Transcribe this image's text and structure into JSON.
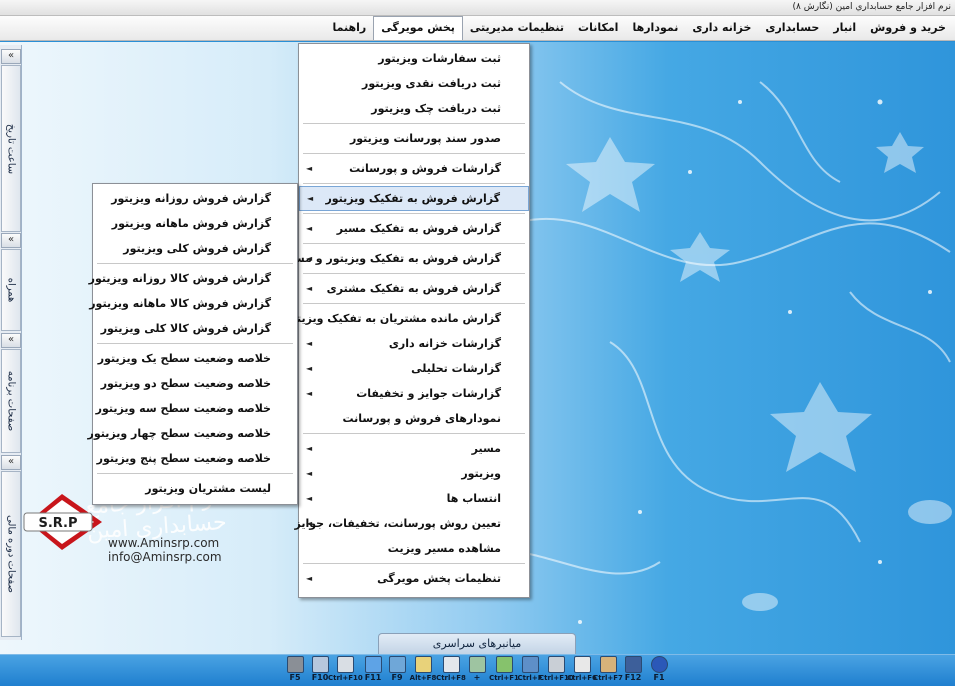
{
  "window": {
    "title": "نرم افزار جامع حسابداري امين (نگارش ۸)"
  },
  "menubar": {
    "items": [
      "خرید و فروش",
      "انبار",
      "حسابداری",
      "خزانه داری",
      "نمودارها",
      "امکانات",
      "تنظیمات مدیریتی",
      "پخش مویرگی",
      "راهنما"
    ],
    "active": "پخش مویرگی"
  },
  "dropdown": {
    "items": [
      {
        "label": "ثبت سفارشات ویزیتور",
        "submenu": false
      },
      {
        "label": "ثبت دریافت نقدی ویزیتور",
        "submenu": false
      },
      {
        "label": "ثبت دریافت چک ویزیتور",
        "submenu": false
      },
      {
        "label": "صدور سند پورسانت ویزیتور",
        "submenu": false
      },
      {
        "label": "گزارشات فروش و پورسانت",
        "submenu": true
      },
      {
        "label": "گزارش فروش به تفکیک ویزیتور",
        "submenu": true,
        "highlighted": true
      },
      {
        "label": "گزارش فروش به تفکیک مسیر",
        "submenu": true
      },
      {
        "label": "گزارش فروش به تفکیک ویزیتور و مسیر",
        "submenu": true
      },
      {
        "label": "گزارش فروش به تفکیک مشتری",
        "submenu": true
      },
      {
        "label": "گزارش مانده مشتریان به تفکیک ویزیتور",
        "submenu": false
      },
      {
        "label": "گزارشات خزانه داری",
        "submenu": true
      },
      {
        "label": "گزارشات تحلیلی",
        "submenu": true
      },
      {
        "label": "گزارشات جوایز و تخفیفات",
        "submenu": true
      },
      {
        "label": "نمودارهای فروش و پورسانت",
        "submenu": false
      },
      {
        "label": "مسیر",
        "submenu": true
      },
      {
        "label": "ویزیتور",
        "submenu": true
      },
      {
        "label": "انتساب ها",
        "submenu": true
      },
      {
        "label": "تعیین روش پورسانت، تخفیفات، جوایز",
        "submenu": true
      },
      {
        "label": "مشاهده مسیر ویزیت",
        "submenu": false
      },
      {
        "label": "تنظیمات پخش مویرگی",
        "submenu": true
      }
    ]
  },
  "submenu": {
    "items": [
      "گزارش فروش روزانه ویزیتور",
      "گزارش فروش ماهانه ویزیتور",
      "گزارش فروش کلی ویزیتور",
      "گزارش فروش کالا روزانه ویزیتور",
      "گزارش فروش کالا ماهانه ویزیتور",
      "گزارش فروش کالا کلی ویزیتور",
      "خلاصه وضعیت سطح یک ویزیتور",
      "خلاصه وضعیت سطح دو ویزیتور",
      "خلاصه وضعیت سطح سه ویزیتور",
      "خلاصه وضعیت سطح چهار ویزیتور",
      "خلاصه وضعیت سطح پنج ویزیتور",
      "لیست مشتریان ویزیتور"
    ]
  },
  "leftpanel": {
    "collapse_glyph": "«",
    "tabs": [
      "ساعت تاریخ",
      "همراه",
      "صفحات برنامه",
      "صفحات دوره مالی"
    ]
  },
  "brand": {
    "logo_text": "S.R.P",
    "website": "www.Aminsrp.com",
    "email": "info@Aminsrp.com",
    "slogan": "نرم افزار جامع حسابداری امین"
  },
  "status_tab": {
    "label": "میانبرهای سراسری"
  },
  "toolbar": {
    "buttons": [
      {
        "name": "calculator",
        "key": "F5",
        "color": "#8a8f96"
      },
      {
        "name": "documents",
        "key": "F10",
        "color": "#b6c7dd"
      },
      {
        "name": "edit-form",
        "key": "Ctrl+F10",
        "color": "#d9dee4"
      },
      {
        "name": "email",
        "key": "F11",
        "color": "#5ea3e6"
      },
      {
        "name": "search",
        "key": "F9",
        "color": "#6fa7d8"
      },
      {
        "name": "report",
        "key": "Alt+F8",
        "color": "#e8d27a"
      },
      {
        "name": "list",
        "key": "Ctrl+F8",
        "color": "#e3e7ec"
      },
      {
        "name": "add",
        "key": "+",
        "color": "#9ec4a1"
      },
      {
        "name": "grid",
        "key": "Ctrl+F1",
        "color": "#86c26c"
      },
      {
        "name": "users",
        "key": "Ctrl+F",
        "color": "#5e8fc8"
      },
      {
        "name": "settings",
        "key": "Ctrl+F10",
        "color": "#c9cfd6"
      },
      {
        "name": "pen",
        "key": "Ctrl+F6",
        "color": "#e8e8e8"
      },
      {
        "name": "notebook",
        "key": "Ctrl+F7",
        "color": "#d7b27a"
      },
      {
        "name": "monitor",
        "key": "F12",
        "color": "#3d5f9a"
      },
      {
        "name": "help",
        "key": "F1",
        "color": "#2b58b8"
      }
    ]
  }
}
